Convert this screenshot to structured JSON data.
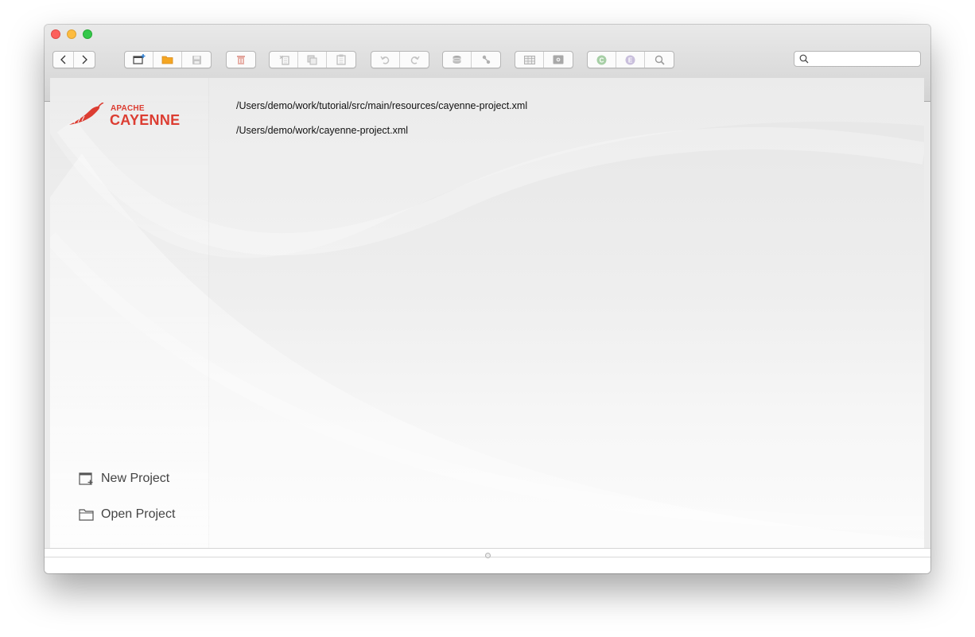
{
  "window": {
    "traffic_lights": [
      "close",
      "minimize",
      "zoom"
    ]
  },
  "toolbar": {
    "groups": [
      [
        "back-icon",
        "forward-icon"
      ],
      [
        "new-project-icon",
        "open-project-icon",
        "save-icon"
      ],
      [
        "remove-icon"
      ],
      [
        "cut-icon",
        "copy-icon",
        "paste-icon"
      ],
      [
        "undo-icon",
        "redo-icon"
      ],
      [
        "create-datanode-icon",
        "create-relationship-icon"
      ],
      [
        "create-table-icon",
        "create-procedure-icon"
      ],
      [
        "create-class-icon",
        "create-entity-icon",
        "query-icon"
      ]
    ],
    "search": {
      "value": "",
      "placeholder": ""
    }
  },
  "sidebar": {
    "logo": {
      "top": "APACHE",
      "bottom": "CAYENNE"
    },
    "actions": [
      {
        "label": "New Project",
        "icon": "new-project-icon"
      },
      {
        "label": "Open Project",
        "icon": "folder-icon"
      }
    ]
  },
  "recent_projects": [
    "/Users/demo/work/tutorial/src/main/resources/cayenne-project.xml",
    "/Users/demo/work/cayenne-project.xml"
  ],
  "colors": {
    "brand": "#dc3d32",
    "toolbar_active": "#f4a623",
    "toolbar_disabled": "#b0b0b0"
  }
}
